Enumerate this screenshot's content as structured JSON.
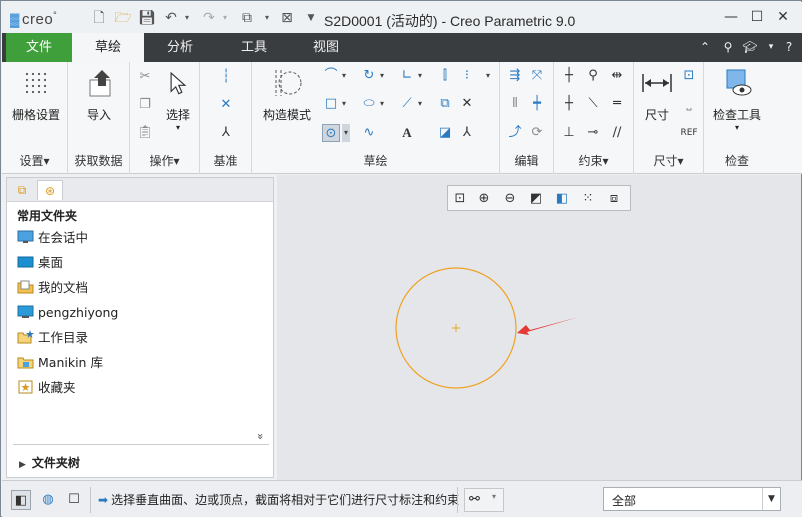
{
  "app": {
    "logo": "creo",
    "window_title": "S2D0001 (活动的) - Creo Parametric 9.0"
  },
  "window_controls": {
    "minimize": "—",
    "maximize": "☐",
    "close": "✕"
  },
  "tabs": [
    {
      "label": "文件"
    },
    {
      "label": "草绘"
    },
    {
      "label": "分析"
    },
    {
      "label": "工具"
    },
    {
      "label": "视图"
    }
  ],
  "ribbon": {
    "groups": {
      "setup": {
        "label": "设置",
        "dropdown": "▾",
        "button": "栅格设置"
      },
      "get_data": {
        "label": "获取数据",
        "button": "导入"
      },
      "operations": {
        "label": "操作",
        "dropdown": "▾",
        "button": "选择"
      },
      "datum": {
        "label": "基准"
      },
      "sketch": {
        "label": "草绘",
        "button": "构造模式"
      },
      "edit": {
        "label": "编辑"
      },
      "constrain": {
        "label": "约束",
        "dropdown": "▾"
      },
      "dimension": {
        "label": "尺寸",
        "dropdown": "▾",
        "button": "尺寸"
      },
      "inspect": {
        "label": "检查",
        "button": "检查工具"
      }
    },
    "text_icon": "A"
  },
  "left_panel": {
    "heading": "常用文件夹",
    "items": [
      {
        "label": "在会话中",
        "icon": "monitor-icon"
      },
      {
        "label": "桌面",
        "icon": "desktop-icon"
      },
      {
        "label": "我的文档",
        "icon": "documents-icon"
      },
      {
        "label": "pengzhiyong",
        "icon": "user-computer-icon"
      },
      {
        "label": "工作目录",
        "icon": "working-dir-icon"
      },
      {
        "label": "Manikin 库",
        "icon": "library-icon"
      },
      {
        "label": "收藏夹",
        "icon": "favorites-icon"
      }
    ],
    "more": "»",
    "folder_tree": "文件夹树"
  },
  "status": {
    "message": "选择垂直曲面、边或顶点，截面将相对于它们进行尺寸标注和约束",
    "filter_value": "全部"
  },
  "colors": {
    "file_tab": "#3f9f3a",
    "tabbar": "#3a3d40",
    "circle": "#f0a020",
    "arrow": "#e53935",
    "icon_blue": "#2a7ac0"
  }
}
